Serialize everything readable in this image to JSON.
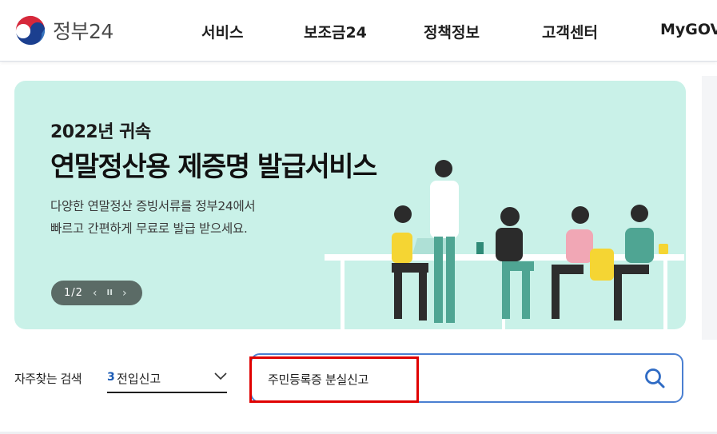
{
  "header": {
    "logo_text": "정부24",
    "nav": [
      {
        "label": "서비스"
      },
      {
        "label": "보조금24"
      },
      {
        "label": "정책정보"
      },
      {
        "label": "고객센터"
      },
      {
        "label": "MyGOV"
      }
    ]
  },
  "banner": {
    "subtitle": "2022년 귀속",
    "title": "연말정산용 제증명 발급서비스",
    "desc_line1": "다양한 연말정산 증빙서류를 정부24에서",
    "desc_line2": "빠르고 간편하게 무료로 발급 받으세요.",
    "pager": {
      "count": "1/2",
      "prev": "‹",
      "pause": "II",
      "next": "›"
    }
  },
  "search": {
    "quick_label": "자주찾는 검색",
    "quick_selected_num": "3",
    "quick_selected_text": "전입신고",
    "query": "주민등록증 분실신고"
  },
  "colors": {
    "banner_bg": "#c9f1e8",
    "accent_blue": "#4a7fd1",
    "highlight_red": "#e00000"
  }
}
